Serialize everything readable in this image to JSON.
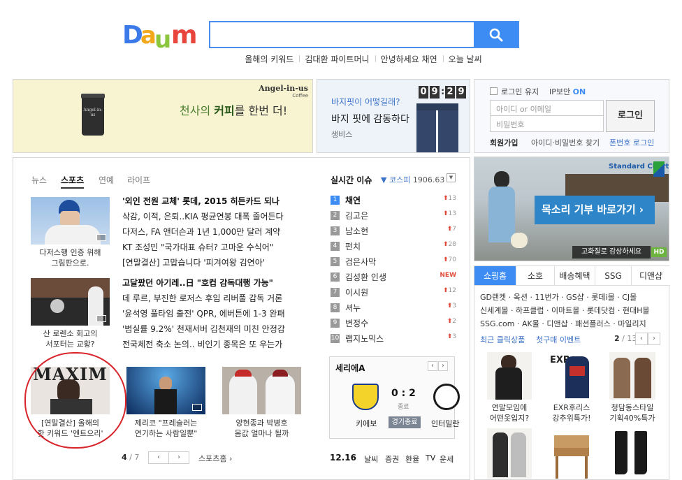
{
  "header": {
    "logo_text": "Daum",
    "search_placeholder": "",
    "keywords": [
      "올해의 키워드",
      "김대환 파이트머니",
      "안녕하세요 채연",
      "오늘 날씨"
    ]
  },
  "ad1": {
    "brand": "Angel-in-us",
    "brand_sub": "Coffee",
    "cup_text": "Angel-in-us",
    "slogan_pre": "천사의 ",
    "slogan_hl": "커피",
    "slogan_post": "를 한번 더!"
  },
  "ad2": {
    "q": "바지핏이 어떻길래?",
    "title": "바지 핏에 감동하다",
    "sub": "생비스",
    "clock": [
      "0",
      "9",
      "2",
      "9"
    ]
  },
  "login": {
    "keep": "로그인 유지",
    "ip": "IP보안",
    "ip_state": "ON",
    "id_ph": "아이디 or 이메일",
    "pw_ph": "비밀번호",
    "btn": "로그인",
    "join": "회원가입",
    "find": "아이디·비밀번호 찾기",
    "phone": "폰번호 로그인"
  },
  "news": {
    "tabs": [
      "뉴스",
      "스포츠",
      "연예",
      "라이프"
    ],
    "active_tab": "스포츠",
    "group1": [
      "'외인 전원 교체' 롯데, 2015 히든카드 되나",
      "삭감, 이적, 은퇴..KIA 평균연봉 대폭 줄어든다",
      "다저스, FA 앤더슨과 1년 1,000만 달러 계약",
      "KT 조성민 \"국가대표 슈터? 고마운 수식어\"",
      "[연말결산] 고맙습니다 '피겨여왕 김연아'"
    ],
    "group2": [
      "고달팠던 아기레..日 \"호컵 감독대행 가능\"",
      "데 루르, 부진한 로저스 후임 리버풀 감독 거론",
      "'윤석영 풀타임 출전' QPR, 에버튼에 1-3 완패",
      "'범실률 9.2%' 천재서버 김천재의 미친 안정감",
      "전국체전 축소 논의.. 비인기 종목은 또 우는가"
    ],
    "cap1": [
      "다저스행 인증 위해",
      "그림판으로."
    ],
    "cap2": [
      "산 로렌소 회고의",
      "서포터는 교황?"
    ],
    "cap3": [
      "[연말결산] 올해의",
      "핫 키워드 '엔트으리'"
    ],
    "cap4": [
      "제리코 \"프레슬러는",
      "연기하는 사람일뿐\""
    ],
    "cap5": [
      "양현종과 박병호",
      "몸값 얼마나 될까"
    ],
    "magazine": "MAXIM",
    "pager": "4",
    "pager_total": "/ 7",
    "more": "스포츠홈"
  },
  "issues": {
    "title": "실시간 이슈",
    "index_label": "코스피",
    "index_value": "1906.63",
    "items": [
      {
        "n": "1",
        "t": "채연",
        "c": "13"
      },
      {
        "n": "2",
        "t": "김고은",
        "c": "13"
      },
      {
        "n": "3",
        "t": "남소현",
        "c": "7"
      },
      {
        "n": "4",
        "t": "펀치",
        "c": "28"
      },
      {
        "n": "5",
        "t": "검은사막",
        "c": "70"
      },
      {
        "n": "6",
        "t": "김성환 인생",
        "c": "NEW"
      },
      {
        "n": "7",
        "t": "이시원",
        "c": "12"
      },
      {
        "n": "8",
        "t": "셔누",
        "c": "3"
      },
      {
        "n": "9",
        "t": "변정수",
        "c": "2"
      },
      {
        "n": "10",
        "t": "랩지노믹스",
        "c": "3"
      }
    ]
  },
  "serie": {
    "title": "세리에A",
    "home": "키에보",
    "away": "인터밀란",
    "score": "0 : 2",
    "state": "종료",
    "btn": "경기종료"
  },
  "bottom": {
    "date": "12.16",
    "links": [
      "날씨",
      "증권",
      "환율",
      "TV",
      "운세"
    ]
  },
  "banner": {
    "brand": "Standard Chartered",
    "cta": "목소리 기부 바로가기",
    "hd": "고화질로 감상하세요",
    "hd_badge": "HD"
  },
  "shopping": {
    "tabs": [
      "쇼핑홈",
      "소호",
      "배송혜택",
      "SSG",
      "디앤샵"
    ],
    "line1": "GD랜켓 · 옥션 · 11번가 · GS샵 · 롯데i몰 · CJ몰",
    "line2": "신세계몰 · 하프클럽 · 이마트몰 · 롯데닷컴 · 현대H몰",
    "line3": "SSG.com · AK몰 · 디앤샵 · 패션플러스 · 마일리지",
    "recent": "최근 클릭상품",
    "first": "첫구매 이벤트",
    "page": "2",
    "page_total": "/ 13",
    "p1": [
      "연말모임에",
      "어떤옷입지?"
    ],
    "p2": [
      "EXR후리스",
      "강추위특가!"
    ],
    "p3": [
      "청담동스타일",
      "기획40%특가"
    ]
  },
  "colors": {
    "accent": "#3d8cf3",
    "rank_up": "#e04a3a",
    "highlight_circle": "#d8232a"
  }
}
